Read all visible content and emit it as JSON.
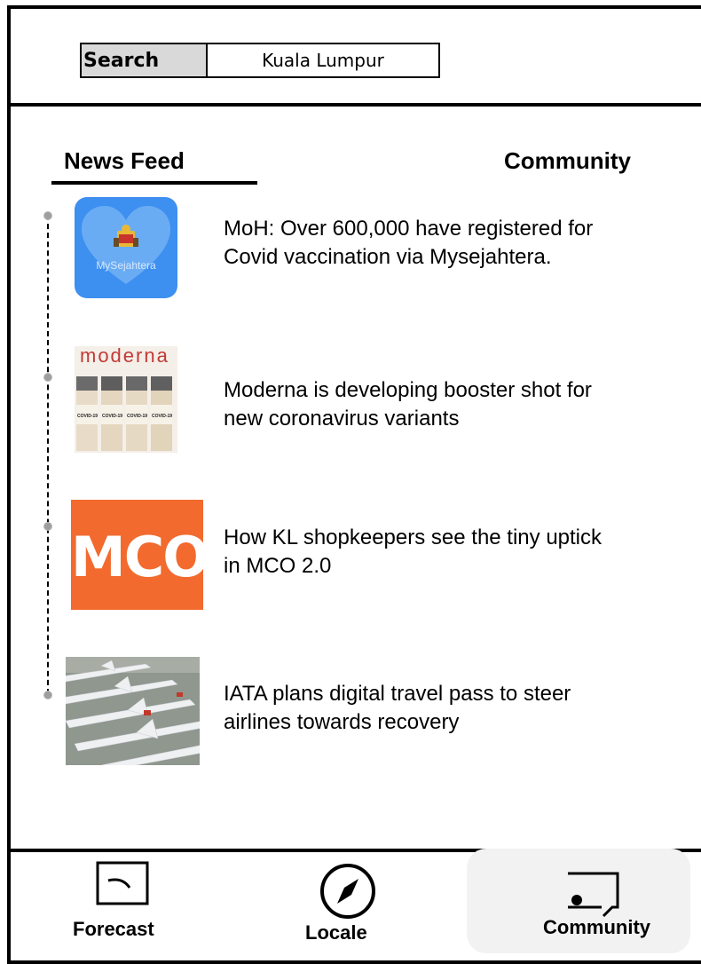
{
  "search": {
    "label": "Search",
    "value": "Kuala Lumpur"
  },
  "tabs": [
    {
      "label": "News Feed",
      "active": true
    },
    {
      "label": "Community",
      "active": false
    }
  ],
  "news": [
    {
      "headline_line1": "MoH: Over 600,000 have registered for",
      "headline_line2": "Covid vaccination via Mysejahtera.",
      "thumb_text": "MySejahtera",
      "thumb_icon": "heart-logo"
    },
    {
      "headline_line1": "Moderna is developing booster shot for",
      "headline_line2": "new coronavirus variants",
      "thumb_text": "moderna",
      "vial_label": "COVID-19",
      "thumb_icon": "vaccine-vials"
    },
    {
      "headline_line1": "How KL shopkeepers see the tiny uptick",
      "headline_line2": "in MCO 2.0",
      "thumb_text": "MCO",
      "thumb_icon": "mco-logo"
    },
    {
      "headline_line1": "IATA plans digital travel pass to steer",
      "headline_line2": "airlines towards recovery",
      "thumb_icon": "parked-airplanes"
    }
  ],
  "nav": [
    {
      "label": "Forecast",
      "icon": "forecast-icon"
    },
    {
      "label": "Locale",
      "icon": "compass-icon"
    },
    {
      "label": "Community",
      "icon": "community-icon",
      "active": true
    }
  ],
  "colors": {
    "mysejahtera_blue": "#3d8ff0",
    "mco_orange": "#f26a2e",
    "search_label_bg": "#d9d9d9",
    "active_nav_bg": "#f2f2f2"
  }
}
